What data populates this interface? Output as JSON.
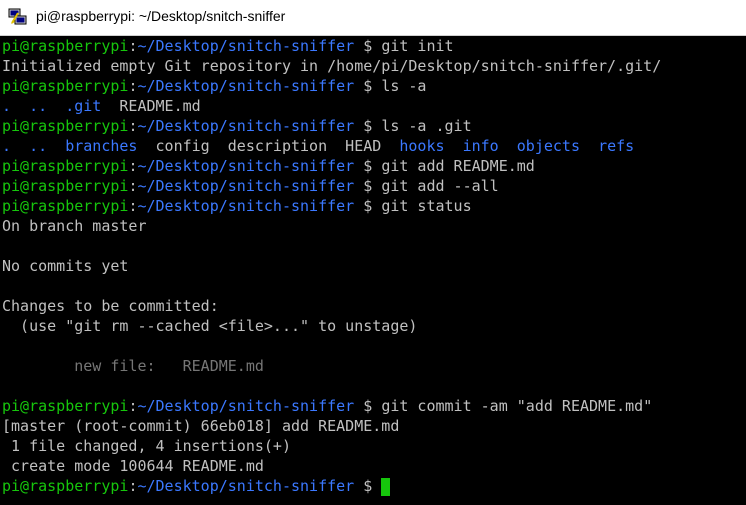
{
  "window": {
    "title": "pi@raspberrypi: ~/Desktop/snitch-sniffer"
  },
  "prompt": {
    "user_host": "pi@raspberrypi",
    "sep": ":",
    "path": "~/Desktop/snitch-sniffer",
    "symbol": " $ "
  },
  "lines": {
    "l0_cmd": "git init",
    "l1_out": "Initialized empty Git repository in /home/pi/Desktop/snitch-sniffer/.git/",
    "l2_cmd": "ls -a",
    "l3_a": ".  ..  ",
    "l3_b": ".git",
    "l3_c": "  README.md",
    "l4_cmd": "ls -a .git",
    "l5_a": ".  ..  ",
    "l5_branches": "branches",
    "l5_b": "  config  description  HEAD  ",
    "l5_hooks": "hooks",
    "l5_s1": "  ",
    "l5_info": "info",
    "l5_s2": "  ",
    "l5_objects": "objects",
    "l5_s3": "  ",
    "l5_refs": "refs",
    "l6_cmd": "git add README.md",
    "l7_cmd": "git add --all",
    "l8_cmd": "git status",
    "l9_out": "On branch master",
    "l11_out": "No commits yet",
    "l13_out": "Changes to be committed:",
    "l14_out": "  (use \"git rm --cached <file>...\" to unstage)",
    "l16_out": "        new file:   README.md",
    "l18_cmd": "git commit -am \"add README.md\"",
    "l19_out": "[master (root-commit) 66eb018] add README.md",
    "l20_out": " 1 file changed, 4 insertions(+)",
    "l21_out": " create mode 100644 README.md"
  },
  "colors": {
    "background": "#000000",
    "text": "#c0c0c0",
    "prompt_user": "#16c60c",
    "prompt_path": "#3b78ff",
    "directory": "#3b78ff",
    "staged_file": "#767676",
    "cursor": "#16c60c"
  },
  "icons": {
    "app": "putty-icon"
  }
}
